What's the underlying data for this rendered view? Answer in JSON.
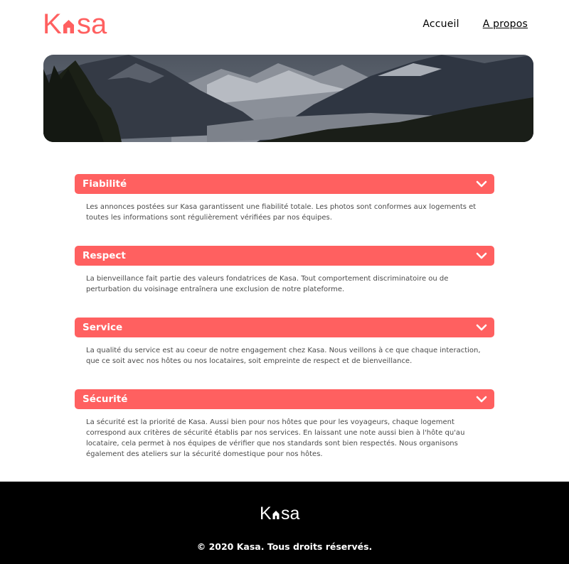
{
  "brand": {
    "logo_text": "Kasa",
    "accent_color": "#ff6060"
  },
  "nav": {
    "items": [
      {
        "label": "Accueil",
        "active": false
      },
      {
        "label": "A propos",
        "active": true
      }
    ]
  },
  "banner": {
    "image": "mountain-valley-landscape"
  },
  "sections": [
    {
      "title": "Fiabilité",
      "text": "Les annonces postées sur Kasa garantissent une fiabilité totale. Les photos sont conformes aux logements et toutes les informations sont régulièrement vérifiées par nos équipes."
    },
    {
      "title": "Respect",
      "text": "La bienveillance fait partie des valeurs fondatrices de Kasa. Tout comportement discriminatoire ou de perturbation du voisinage entraînera une exclusion de notre plateforme."
    },
    {
      "title": "Service",
      "text": "La qualité du service est au coeur de notre engagement chez Kasa. Nous veillons à ce que chaque interaction, que ce soit avec nos hôtes ou nos locataires, soit empreinte de respect et de bienveillance."
    },
    {
      "title": "Sécurité",
      "text": "La sécurité est la priorité de Kasa. Aussi bien pour nos hôtes que pour les voyageurs, chaque logement correspond aux critères de sécurité établis par nos services. En laissant une note aussi bien à l'hôte qu'au locataire, cela permet à nos équipes de vérifier que nos standards sont bien respectés. Nous organisons également des ateliers sur la sécurité domestique pour nos hôtes."
    }
  ],
  "footer": {
    "logo_text": "Kasa",
    "copyright": "© 2020 Kasa. Tous droits réservés."
  }
}
